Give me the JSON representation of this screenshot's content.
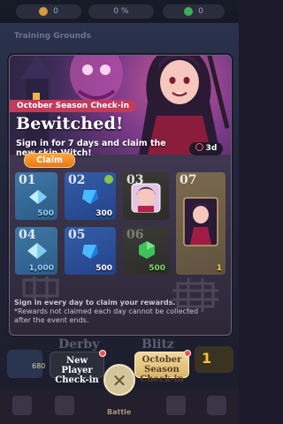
{
  "topbar": {
    "left_res": "0",
    "mid_res": "0 %",
    "right_res": "0"
  },
  "background": {
    "area_title": "Training Grounds",
    "mode_left": "Derby",
    "mode_right": "Blitz",
    "left_count": "680",
    "right_value": "1"
  },
  "modal": {
    "season_label": "October Season Check-in",
    "title": "Bewitched!",
    "subtitle": "Sign in for 7 days and claim the new skin Witch!",
    "days_left": "3d",
    "claim_label": "Claim",
    "notes": [
      "Sign in every day to claim your rewards.",
      "*Rewards not claimed each day cannot be collected after the event ends."
    ],
    "rewards": [
      {
        "day": "01",
        "amount": "500",
        "item": "diamond",
        "color": "#8fd2ff"
      },
      {
        "day": "02",
        "amount": "300",
        "item": "sapphire"
      },
      {
        "day": "03",
        "amount": "",
        "item": "witch-avatar"
      },
      {
        "day": "04",
        "amount": "1,000",
        "item": "diamond"
      },
      {
        "day": "05",
        "amount": "500",
        "item": "sapphire"
      },
      {
        "day": "06",
        "amount": "500",
        "item": "emerald"
      },
      {
        "day": "07",
        "amount": "1",
        "item": "witch-skin"
      }
    ]
  },
  "tabs": {
    "new_player": "New Player Check-in",
    "october": "October Season Check-in",
    "battle": "Battle"
  },
  "colors": {
    "claim": "#ff8a2a",
    "season_chip": "#c23b5c",
    "selected_tab": "#e8cb87"
  }
}
